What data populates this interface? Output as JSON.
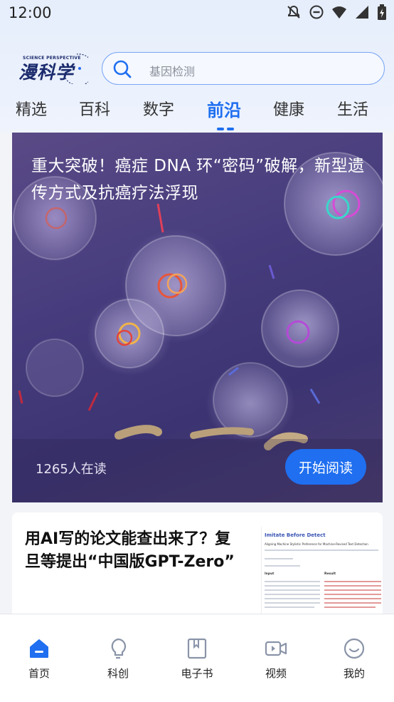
{
  "status_bar": {
    "time": "12:00",
    "icons": [
      "notifications-off-icon",
      "do-not-disturb-icon",
      "wifi-icon",
      "signal-icon",
      "battery-charging-icon"
    ]
  },
  "header": {
    "logo_small": "SCIENCE PERSPECTIVE",
    "logo_main": "漫科学",
    "search_placeholder": "基因检测"
  },
  "tabs": [
    {
      "label": "精选",
      "active": false
    },
    {
      "label": "百科",
      "active": false
    },
    {
      "label": "数字",
      "active": false
    },
    {
      "label": "前沿",
      "active": true
    },
    {
      "label": "健康",
      "active": false
    },
    {
      "label": "生活",
      "active": false
    }
  ],
  "hero": {
    "title": "重大突破！癌症 DNA 环“密码”破解，新型遗传方式及抗癌疗法浮现",
    "readers": "1265人在读",
    "button_label": "开始阅读"
  },
  "article2": {
    "title": "用AI写的论文能查出来了？复旦等提出“中国版GPT-Zero”",
    "thumbnail": {
      "title": "Imitate Before Detect",
      "subtitle": "Aligning Machine Stylistic Preference for Machine-Revised Text Detection",
      "left_heading": "Input",
      "right_heading": "Result"
    }
  },
  "bottom_nav": [
    {
      "label": "首页",
      "icon": "home-icon",
      "active": true
    },
    {
      "label": "科创",
      "icon": "lightbulb-icon",
      "active": false
    },
    {
      "label": "电子书",
      "icon": "ebook-icon",
      "active": false
    },
    {
      "label": "视频",
      "icon": "video-icon",
      "active": false
    },
    {
      "label": "我的",
      "icon": "profile-smile-icon",
      "active": false
    }
  ],
  "colors": {
    "accent": "#1f6ff0",
    "text": "#111111",
    "muted": "#8a8f99"
  }
}
